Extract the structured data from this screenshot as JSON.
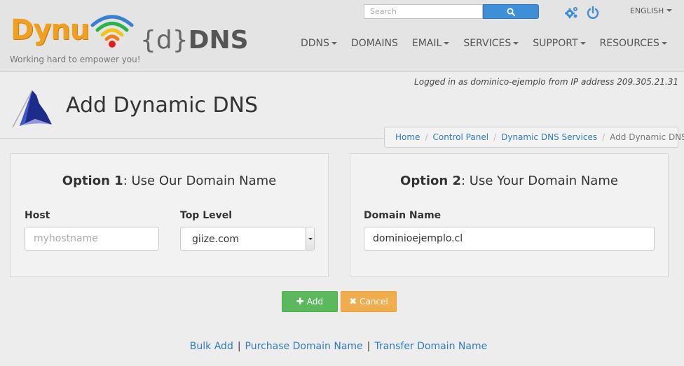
{
  "header": {
    "logo_dynu": "Dynu",
    "logo_brace_open": "{",
    "logo_d": "d",
    "logo_brace_close": "}",
    "logo_dns": "DNS",
    "tagline": "Working hard to empower you!",
    "search_placeholder": "Search",
    "language": "ENGLISH",
    "nav": [
      {
        "label": "DDNS",
        "dropdown": true
      },
      {
        "label": "DOMAINS",
        "dropdown": false
      },
      {
        "label": "EMAIL",
        "dropdown": true
      },
      {
        "label": "SERVICES",
        "dropdown": true
      },
      {
        "label": "SUPPORT",
        "dropdown": true
      },
      {
        "label": "RESOURCES",
        "dropdown": true
      }
    ]
  },
  "status": {
    "logged_in_text": "Logged in as dominico-ejemplo from IP address 209.305.21.31"
  },
  "page": {
    "title": "Add Dynamic DNS"
  },
  "breadcrumb": {
    "home": "Home",
    "control_panel": "Control Panel",
    "services": "Dynamic DNS Services",
    "current": "Add Dynamic DNS"
  },
  "option1": {
    "title_bold": "Option 1",
    "title_rest": ": Use Our Domain Name",
    "host_label": "Host",
    "host_placeholder": "myhostname",
    "host_value": "",
    "toplevel_label": "Top Level",
    "toplevel_selected": "giize.com"
  },
  "option2": {
    "title_bold": "Option 2",
    "title_rest": ": Use Your Domain Name",
    "domain_label": "Domain Name",
    "domain_value": "dominioejemplo.cl"
  },
  "actions": {
    "add_label": "Add",
    "cancel_label": "Cancel"
  },
  "links": {
    "bulk_add": "Bulk Add",
    "purchase": "Purchase Domain Name",
    "transfer": "Transfer Domain Name",
    "separator": "|"
  },
  "colors": {
    "accent_blue": "#3e8fd8",
    "link_blue": "#2f7bc1",
    "add_green": "#5cb85c",
    "cancel_orange": "#f0ad4e",
    "logo_orange": "#f0a020"
  },
  "icons": {
    "search": "search-icon",
    "settings": "gear-icon",
    "power": "power-icon",
    "add": "plus-icon",
    "cancel": "close-icon",
    "page": "flag-icon"
  }
}
